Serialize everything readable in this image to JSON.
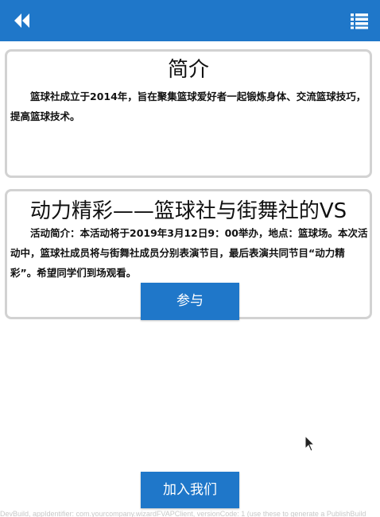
{
  "header": {
    "back_icon": "double-chevron-left-icon",
    "menu_icon": "list-menu-icon",
    "bar_color": "#1f77c9"
  },
  "intro": {
    "title": "简介",
    "text": "篮球社成立于2014年，旨在聚集篮球爱好者一起锻炼身体、交流篮球技巧，提高篮球技术。"
  },
  "event": {
    "title": "动力精彩——篮球社与街舞社的VS",
    "text": "活动简介：本活动将于2019年3月12日9：00举办，地点：篮球场。本次活动中，篮球社成员将与街舞社成员分别表演节目，最后表演共同节目“动力精彩”。希望同学们到场观看。",
    "button_label": "参与"
  },
  "join": {
    "button_label": "加入我们"
  },
  "footer": {
    "text": "DevBuild, appIdentifier: com.yourcompany.wizardFVAPClient, versionCode: 1 (use these to generate a PublishBuild"
  }
}
